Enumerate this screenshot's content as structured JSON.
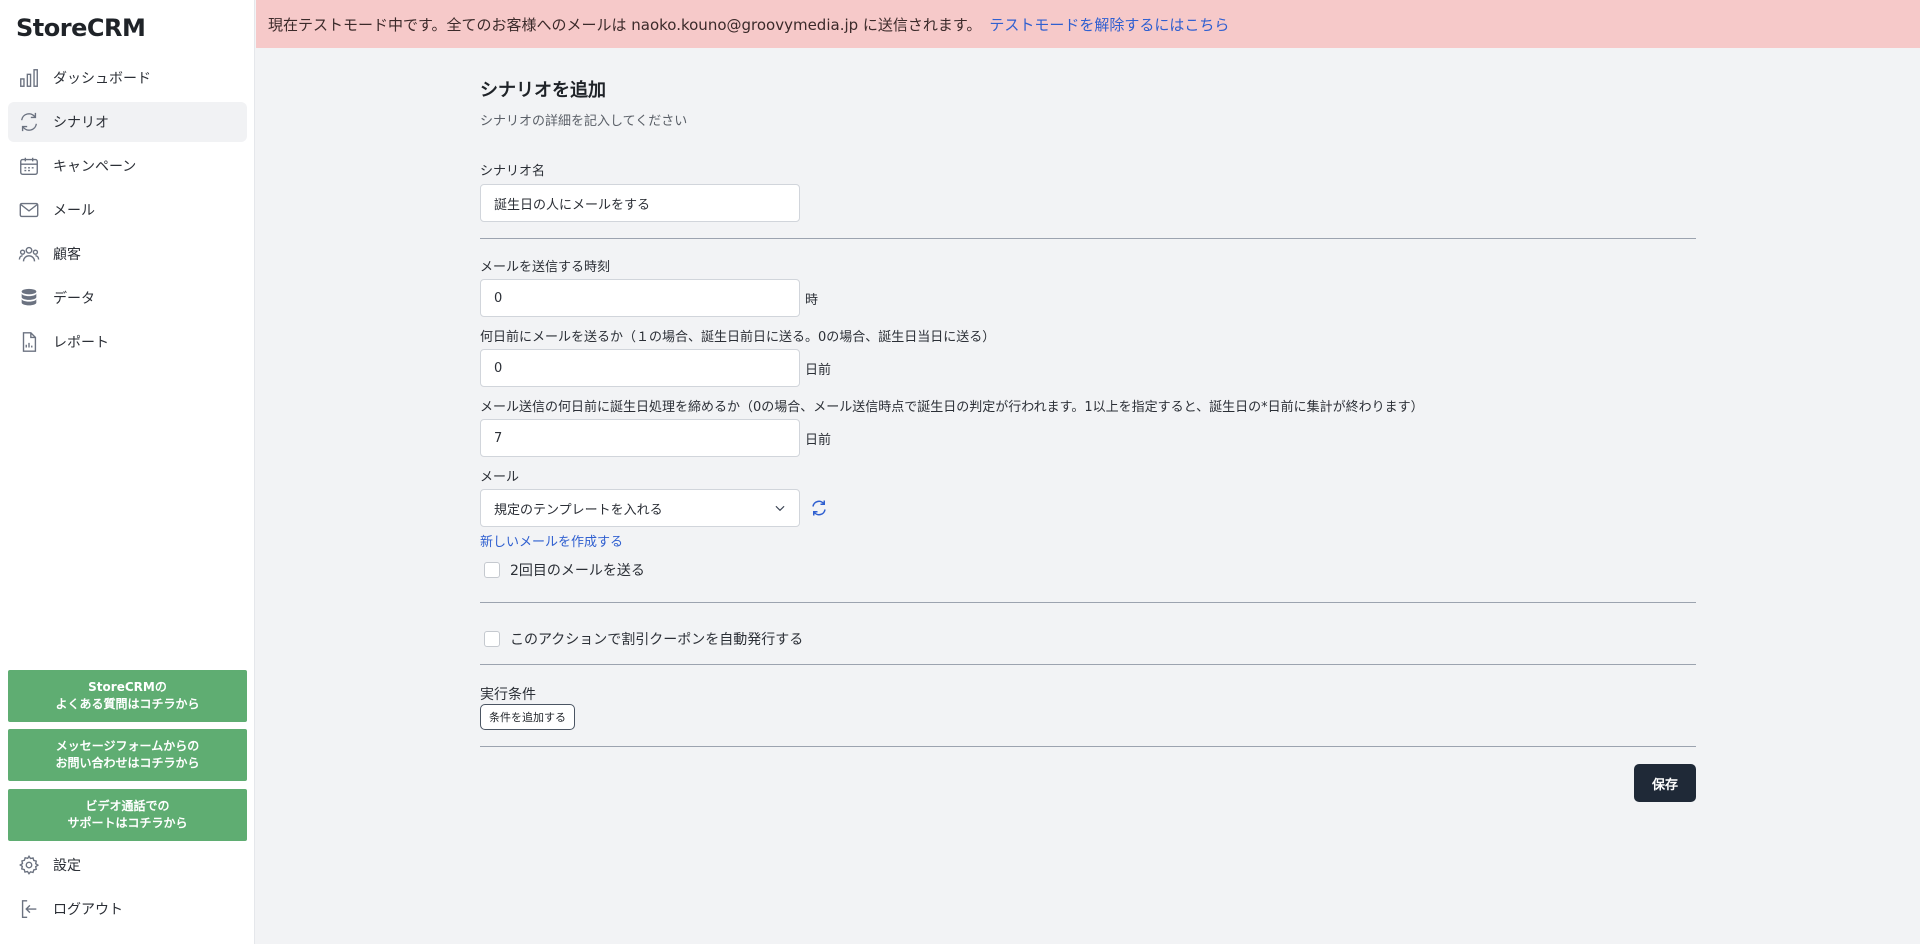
{
  "sidebar": {
    "logo": "StoreCRM",
    "items": [
      {
        "label": "ダッシュボード",
        "icon": "bar-chart-icon"
      },
      {
        "label": "シナリオ",
        "icon": "refresh-icon",
        "active": true
      },
      {
        "label": "キャンペーン",
        "icon": "calendar-icon"
      },
      {
        "label": "メール",
        "icon": "mail-icon"
      },
      {
        "label": "顧客",
        "icon": "users-icon"
      },
      {
        "label": "データ",
        "icon": "database-icon"
      },
      {
        "label": "レポート",
        "icon": "report-icon"
      }
    ],
    "help_buttons": [
      {
        "line1": "StoreCRMの",
        "line2": "よくある質問はコチラから"
      },
      {
        "line1": "メッセージフォームからの",
        "line2": "お問い合わせはコチラから"
      },
      {
        "line1": "ビデオ通話での",
        "line2": "サポートはコチラから"
      }
    ],
    "bottom": [
      {
        "label": "設定",
        "icon": "gear-icon"
      },
      {
        "label": "ログアウト",
        "icon": "logout-icon"
      }
    ]
  },
  "banner": {
    "message": "現在テストモード中です。全てのお客様へのメールは naoko.kouno@groovymedia.jp に送信されます。",
    "link": "テストモードを解除するにはこちら",
    "color": "#f6c9c9"
  },
  "form": {
    "title": "シナリオを追加",
    "subtitle": "シナリオの詳細を記入してください",
    "scenario_name_label": "シナリオ名",
    "scenario_name_value": "誕生日の人にメールをする",
    "send_time_label": "メールを送信する時刻",
    "send_time_value": "0",
    "send_time_unit": "時",
    "days_before_label": "何日前にメールを送るか（１の場合、誕生日前日に送る。0の場合、誕生日当日に送る）",
    "days_before_value": "0",
    "days_before_unit": "日前",
    "cutoff_label": "メール送信の何日前に誕生日処理を締めるか（0の場合、メール送信時点で誕生日の判定が行われます。1以上を指定すると、誕生日の*日前に集計が終わります）",
    "cutoff_value": "7",
    "cutoff_unit": "日前",
    "mail_label": "メール",
    "mail_select_value": "規定のテンプレートを入れる",
    "new_mail_link": "新しいメールを作成する",
    "second_mail_label": "2回目のメールを送る",
    "coupon_label": "このアクションで割引クーポンを自動発行する",
    "conditions_label": "実行条件",
    "add_condition_button": "条件を追加する",
    "save_button": "保存"
  },
  "colors": {
    "accent_green": "#5fad72",
    "link_blue": "#2f5fd0",
    "dark_button": "#1f2937"
  }
}
